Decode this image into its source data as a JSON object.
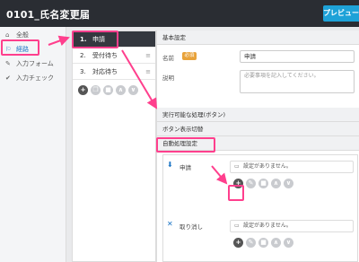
{
  "header": {
    "title": "0101_氏名変更届",
    "preview_label": "プレビュー"
  },
  "sidebar": {
    "items": [
      {
        "label": "全般",
        "icon": "home-icon",
        "glyph": "⌂"
      },
      {
        "label": "経路",
        "icon": "route-icon",
        "glyph": "⚐"
      },
      {
        "label": "入力フォーム",
        "icon": "pencil-icon",
        "glyph": "✎"
      },
      {
        "label": "入力チェック",
        "icon": "check-icon",
        "glyph": "✔"
      }
    ]
  },
  "steps": [
    {
      "num": "1.",
      "label": "申請"
    },
    {
      "num": "2.",
      "label": "受付待ち"
    },
    {
      "num": "3.",
      "label": "対応待ち"
    }
  ],
  "step_tools": {
    "add": "+",
    "move_up": "∧",
    "move_down": "∨"
  },
  "main": {
    "basic_settings": "基本設定",
    "name_label": "名前",
    "required_badge": "必須",
    "name_value": "申請",
    "description_label": "説明",
    "description_placeholder": "必要事項を記入してください。",
    "executable_actions": "実行可能な処理(ボタン)",
    "button_display_toggle": "ボタン表示切替",
    "auto_processing": "自動処理設定",
    "rules": [
      {
        "label": "申請",
        "icon": "submit-icon",
        "none_text": "設定がありません。"
      },
      {
        "label": "取り消し",
        "icon": "cancel-x-icon",
        "none_text": "設定がありません。"
      }
    ]
  },
  "colors": {
    "header": "#2a2d33",
    "accent": "#1ea2d8",
    "highlight": "#ff3f8d",
    "active_step": "#34383f",
    "badge": "#e8a23a"
  }
}
